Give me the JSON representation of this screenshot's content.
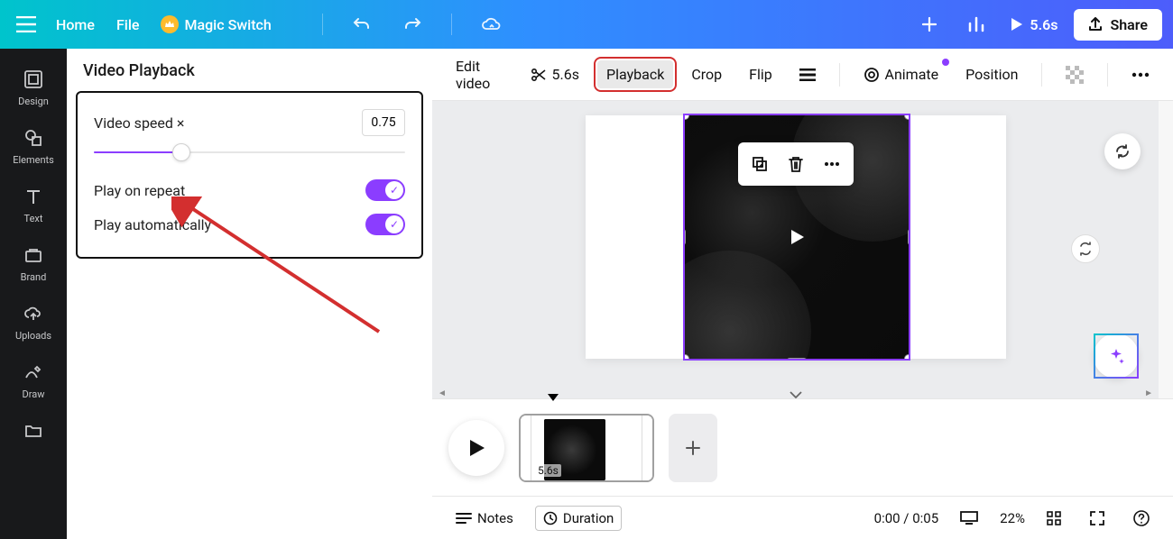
{
  "topbar": {
    "home": "Home",
    "file": "File",
    "magic_switch": "Magic Switch",
    "duration": "5.6s",
    "share": "Share"
  },
  "rail": {
    "design": "Design",
    "elements": "Elements",
    "text": "Text",
    "brand": "Brand",
    "uploads": "Uploads",
    "draw": "Draw"
  },
  "panel": {
    "title": "Video Playback",
    "speed_label": "Video speed ×",
    "speed_value": "0.75",
    "repeat_label": "Play on repeat",
    "auto_label": "Play automatically"
  },
  "tooltop": {
    "edit_video": "Edit video",
    "trim_duration": "5.6s",
    "playback": "Playback",
    "crop": "Crop",
    "flip": "Flip",
    "animate": "Animate",
    "position": "Position"
  },
  "timeline": {
    "clip_duration": "5.6s"
  },
  "statusbar": {
    "notes": "Notes",
    "duration": "Duration",
    "time": "0:00 / 0:05",
    "zoom": "22%"
  }
}
